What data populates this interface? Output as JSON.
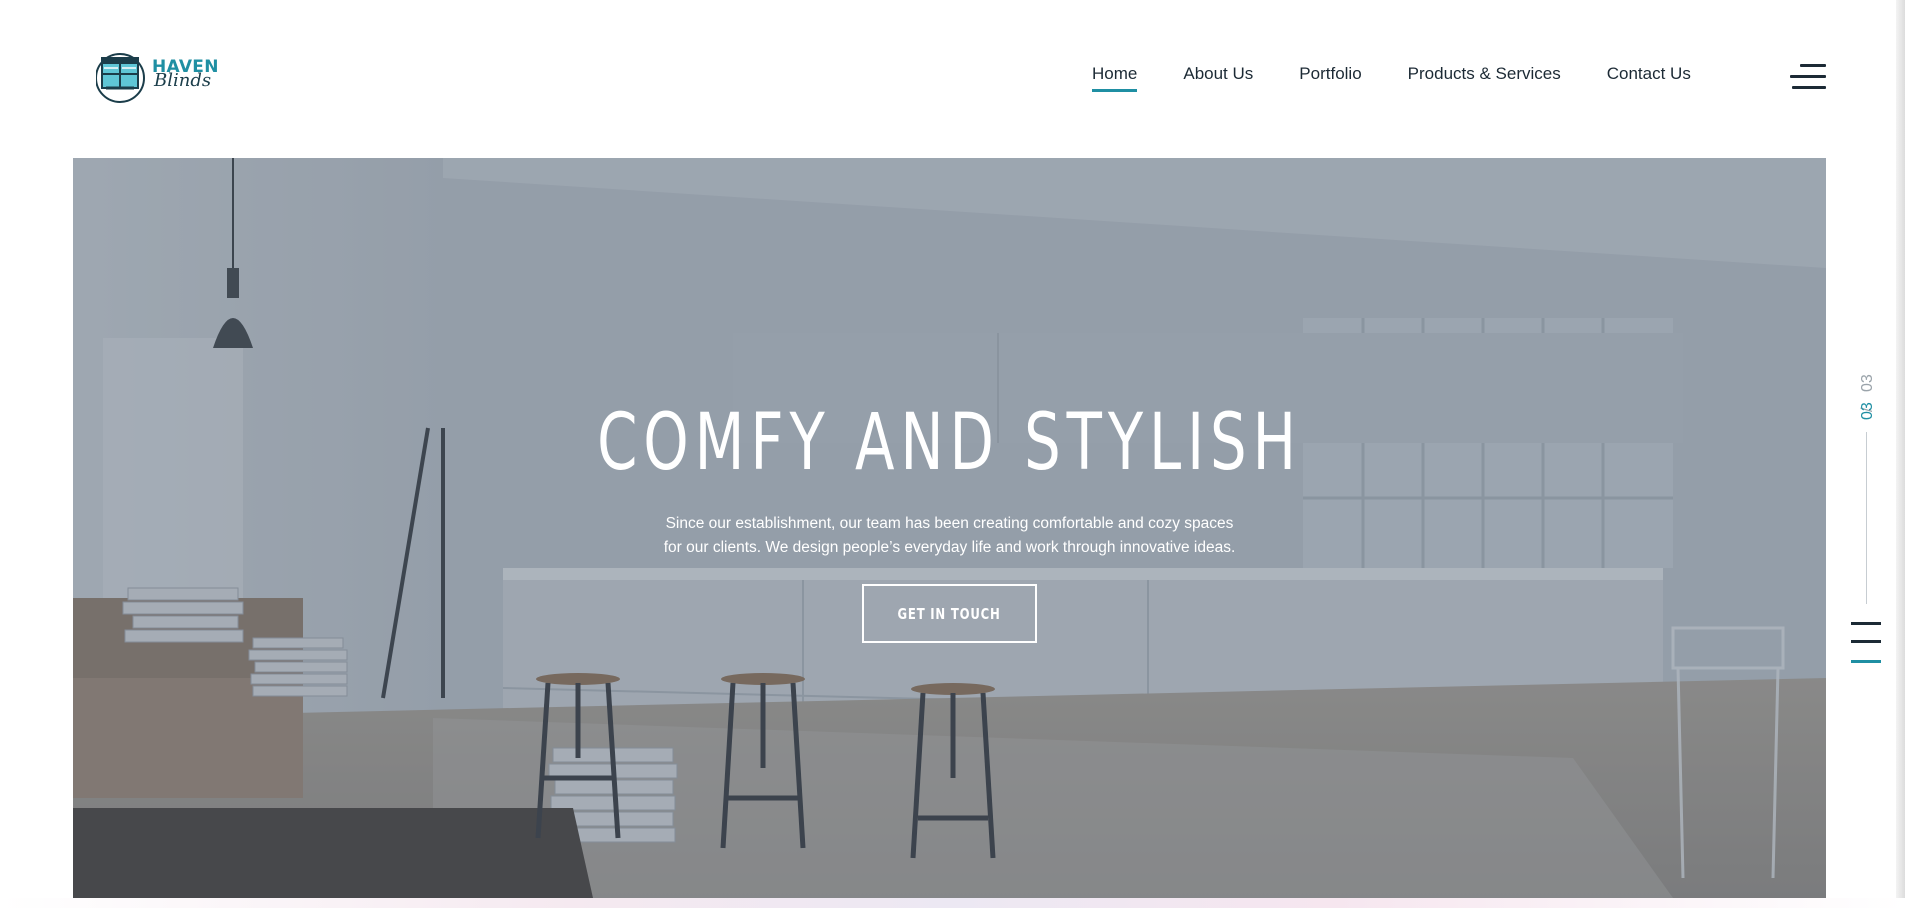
{
  "brand": {
    "name_line1": "HAVEN",
    "name_line2": "Blinds",
    "accent_color": "#1f8fa3",
    "dark_color": "#1c2a35"
  },
  "nav": {
    "items": [
      {
        "label": "Home",
        "active": true
      },
      {
        "label": "About Us",
        "active": false
      },
      {
        "label": "Portfolio",
        "active": false
      },
      {
        "label": "Products & Services",
        "active": false
      },
      {
        "label": "Contact Us",
        "active": false
      }
    ],
    "menu_icon": "hamburger-icon"
  },
  "hero": {
    "title": "COMFY AND STYLISH",
    "description_line1": "Since our establishment, our team has been creating comfortable and cozy spaces",
    "description_line2": "for our clients. We design people’s everyday life and work through innovative ideas.",
    "cta_label": "GET IN TOUCH",
    "background_image": "modern white kitchen interior with bar stools"
  },
  "slider": {
    "current": "03",
    "separator": "/",
    "total": "03",
    "nav_icon": "slide-nav-icon"
  }
}
